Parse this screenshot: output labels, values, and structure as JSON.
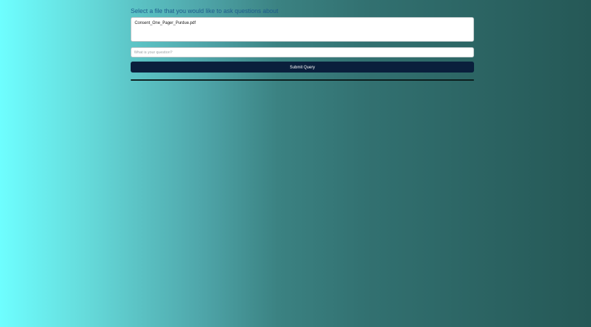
{
  "form": {
    "prompt_label": "Select a file that you would like to ask questions about",
    "files": [
      {
        "label": "Consent_One_Pager_Purdue.pdf"
      }
    ],
    "question_placeholder": "What is your question?",
    "question_value": "",
    "submit_label": "Submit Query"
  },
  "colors": {
    "background_left": "#6efeff",
    "background_right": "#255856",
    "label_text": "#1d5a8c",
    "submit_bg": "#0a1f3c",
    "divider": "#0a1a1a"
  }
}
